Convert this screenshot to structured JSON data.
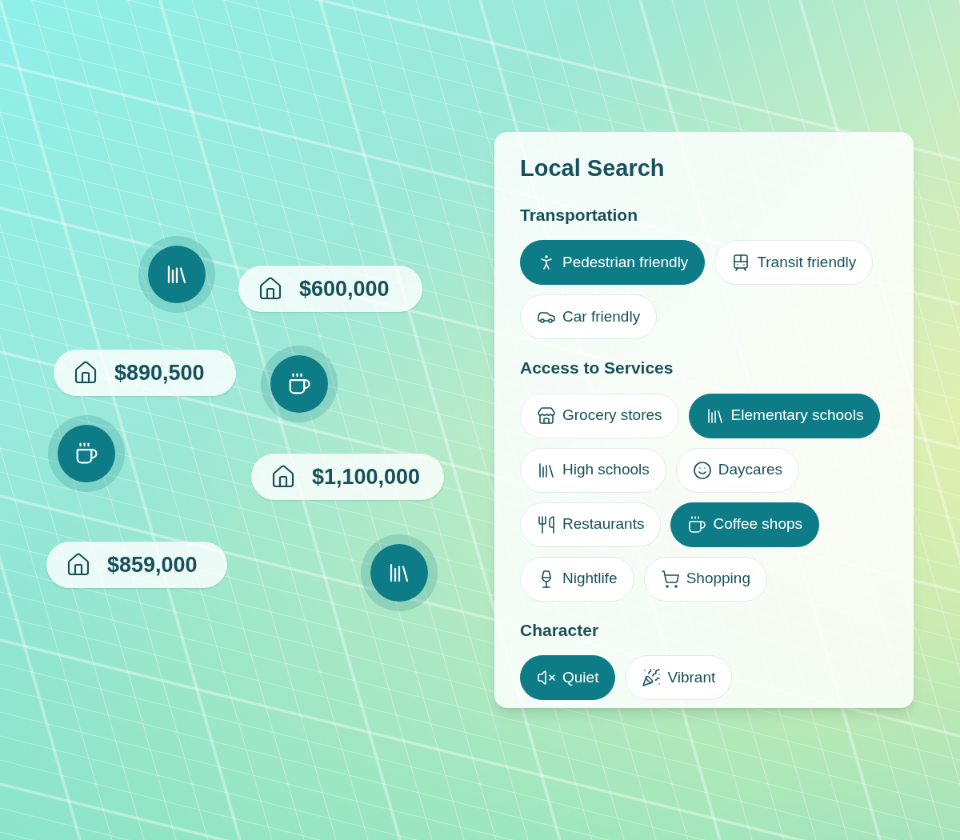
{
  "map": {
    "price_tags": [
      {
        "price": "$600,000"
      },
      {
        "price": "$890,500"
      },
      {
        "price": "$1,100,000"
      },
      {
        "price": "$859,000"
      }
    ],
    "markers": [
      {
        "kind": "books"
      },
      {
        "kind": "coffee"
      },
      {
        "kind": "coffee"
      },
      {
        "kind": "books"
      }
    ]
  },
  "panel": {
    "title": "Local Search",
    "sections": [
      {
        "title": "Transportation",
        "filters": [
          {
            "label": "Pedestrian friendly",
            "selected": true
          },
          {
            "label": "Transit friendly",
            "selected": false
          },
          {
            "label": "Car friendly",
            "selected": false
          }
        ]
      },
      {
        "title": "Access to Services",
        "filters": [
          {
            "label": "Grocery stores",
            "selected": false
          },
          {
            "label": "Elementary schools",
            "selected": true
          },
          {
            "label": "High schools",
            "selected": false
          },
          {
            "label": "Daycares",
            "selected": false
          },
          {
            "label": "Restaurants",
            "selected": false
          },
          {
            "label": "Coffee shops",
            "selected": true
          },
          {
            "label": "Nightlife",
            "selected": false
          },
          {
            "label": "Shopping",
            "selected": false
          }
        ]
      },
      {
        "title": "Character",
        "filters": [
          {
            "label": "Quiet",
            "selected": true
          },
          {
            "label": "Vibrant",
            "selected": false
          }
        ]
      }
    ]
  }
}
